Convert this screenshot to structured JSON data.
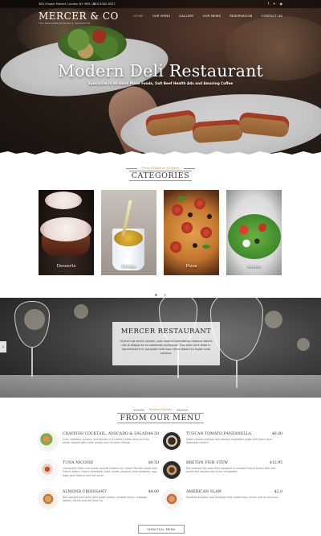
{
  "topbar": {
    "address": "384 Chapel Market, London N1 9EN, UK",
    "phone": "020-3082-6557",
    "social_icons": [
      "facebook-icon",
      "twitter-icon",
      "instagram-icon"
    ]
  },
  "logo": {
    "name": "MERCER & CO",
    "tagline": "THE NEIGHBOURHOOD'S FAVOURITE"
  },
  "nav": {
    "items": [
      "HOME",
      "OUR MENU",
      "GALLERY",
      "OUR NEWS",
      "RESERVATION",
      "CONTACT US"
    ],
    "active": "HOME"
  },
  "hero": {
    "title": "Modern Deli Restaurant",
    "subtitle": "Specialize in all Hand Made Foods, Salt Beef Health Ads and Amazing Coffee"
  },
  "categories": {
    "eyebrow": "From 6.00am to 10.00pm",
    "title": "CATEGORIES",
    "items": [
      "Desserts",
      "Drinks",
      "Pizza",
      "Salads"
    ]
  },
  "mercer": {
    "title": "MERCER RESTAURANT",
    "text": "Ut enim ad minim veniam, quis nostrud exercitation ullamco laboris nisi ut aliquip ex ea commodo consequat. Duis aute irure dolor in reprehenderit in voluptate velit esse cillum dolore eu fugiat nulla pariatur."
  },
  "menu": {
    "eyebrow": "Random Dishes",
    "title": "FROM OUR MENU",
    "items": [
      {
        "name": "CRAYFISH COCKTAIL, AVOCADO & SALAD",
        "price": "$4.50",
        "desc": "Crab, haddock, prawns and salmon in a creamy white wine and fish sauce topped with mash potato and Gruyere cheese"
      },
      {
        "name": "TUSCAN TOMATO PANZANELLA",
        "price": "$6.00",
        "desc": "Goats cheese mousse and roasted vegetable salad with black olive tapenade crostini"
      },
      {
        "name": "TUNA NICOISE",
        "price": "$9.50",
        "desc": "Chargrilled fresh tuna steak layered medium on classic Nicoise salad with French beans, cherry tomatoes, black olives, peppers, new potatoes, egg, baby gem lettuce and red onion"
      },
      {
        "name": "BRETON FISH STEW",
        "price": "$12.95",
        "desc": "Pan roasted Sea bass fillet wrapped in smoked French bacon with pea purée and tomato and chive vinaigrette"
      },
      {
        "name": "ALMOND CROISSANT",
        "price": "$4.00",
        "desc": "Roe roasted pork belly with gratin potato, braised Savoy cabbage, apples, thyme and red wine jus"
      },
      {
        "name": "AMERICAN SLAW",
        "price": "$2.0",
        "desc": "Sauteed breaded veal escalope with watercress, lemon and an anchovy"
      }
    ],
    "button": "VIEW FULL MENU"
  }
}
